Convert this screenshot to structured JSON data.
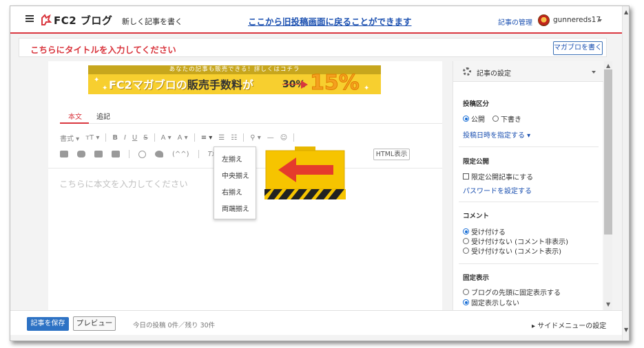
{
  "header": {
    "logo_text": "FC2 ブログ",
    "new_post": "新しく記事を書く",
    "old_editor_link": "ここから旧投稿画面に戻ることができます",
    "manage_link": "記事の管理",
    "username": "gunnereds17"
  },
  "title_field": {
    "placeholder": "こちらにタイトルを入力してください",
    "magablo_button": "マガブロを書く"
  },
  "banner": {
    "top_text": "あなたの記事も販売できる！詳しくはコチラ",
    "main_prefix": "FC2マガブロの",
    "main_highlight": "販売手数料",
    "main_suffix": "が",
    "old_rate": "30%",
    "new_rate": "15%",
    "close": "✕"
  },
  "editor": {
    "tabs": [
      "本文",
      "追記"
    ],
    "toolbar1": {
      "format": "書式 ▾",
      "size": "тT ▾",
      "bold": "B",
      "italic": "I",
      "underline": "U",
      "strike": "S",
      "font_color": "A ▾",
      "bg_color": "A ▾",
      "align": "≡ ▾",
      "ul": "☰",
      "ol": "☷",
      "link": "⚲ ▾",
      "hr": "—",
      "emoji": "☺"
    },
    "toolbar2": {
      "code": "(^^)",
      "clear": "Tx"
    },
    "html_button": "HTML表示",
    "body_placeholder": "こちらに本文を入力してください",
    "align_menu": [
      "左揃え",
      "中央揃え",
      "右揃え",
      "両端揃え"
    ]
  },
  "sidebar": {
    "header_title": "記事の設定",
    "post_type": {
      "title": "投稿区分",
      "options": [
        "公開",
        "下書き"
      ],
      "selected": "公開",
      "date_link": "投稿日時を指定する ▾"
    },
    "limited": {
      "title": "限定公開",
      "checkbox": "限定公開記事にする",
      "password_link": "パスワードを設定する"
    },
    "comment": {
      "title": "コメント",
      "options": [
        "受け付ける",
        "受け付けない (コメント非表示)",
        "受け付けない (コメント表示)"
      ],
      "selected": "受け付ける"
    },
    "pinned": {
      "title": "固定表示",
      "options": [
        "ブログの先頭に固定表示する",
        "固定表示しない"
      ],
      "selected": "固定表示しない"
    }
  },
  "footer": {
    "save": "記事を保存",
    "preview": "プレビュー",
    "today_count": "今日の投稿 0件／残り 30件",
    "side_menu": "▸ サイドメニューの設定"
  },
  "colors": {
    "accent_red": "#d9363e",
    "link_blue": "#1a4fb0",
    "save_blue": "#2d72c4",
    "banner_yellow": "#f7cf2f"
  }
}
